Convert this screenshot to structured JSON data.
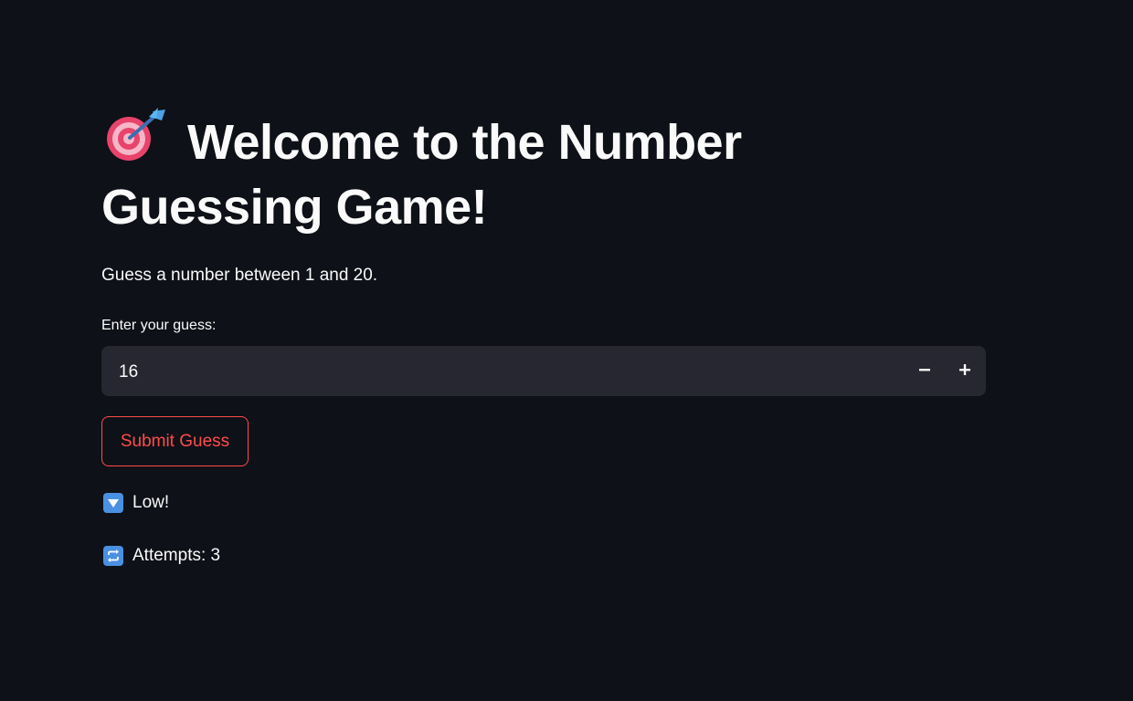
{
  "title": {
    "icon": "dart-target-icon",
    "text": "Welcome to the Number Guessing Game!"
  },
  "subtitle": "Guess a number between 1 and 20.",
  "guess_input": {
    "label": "Enter your guess:",
    "value": "16",
    "decrement_icon": "minus-icon",
    "increment_icon": "plus-icon"
  },
  "submit_button": {
    "label": "Submit Guess"
  },
  "result": {
    "icon": "down-arrow-button-icon",
    "text": "Low!"
  },
  "attempts": {
    "icon": "repeat-button-icon",
    "text": "Attempts: 3"
  },
  "colors": {
    "background": "#0e1117",
    "text": "#fafafa",
    "input_background": "#262730",
    "accent": "#ff4b4b",
    "status_icon_blue": "#4a90e2"
  }
}
